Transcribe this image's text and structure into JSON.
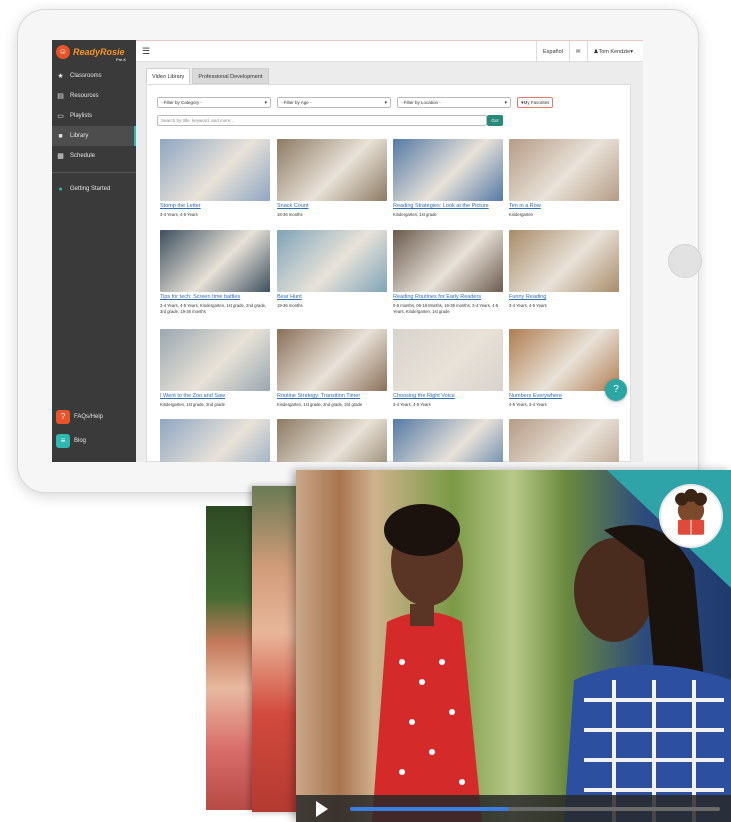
{
  "app": {
    "logo_text": "ReadyRosie",
    "logo_sub": "Pre-K"
  },
  "sidebar": {
    "items": [
      {
        "label": "Classrooms",
        "icon": "star-icon"
      },
      {
        "label": "Resources",
        "icon": "file-icon"
      },
      {
        "label": "Playlists",
        "icon": "monitor-icon"
      },
      {
        "label": "Library",
        "icon": "video-icon",
        "active": true
      },
      {
        "label": "Schedule",
        "icon": "calendar-icon"
      }
    ],
    "getting_started": "Getting Started",
    "faq": "FAQs/Help",
    "blog": "Blog"
  },
  "topbar": {
    "language": "Español",
    "user": "Tom Kendzie"
  },
  "tabs": [
    {
      "label": "Video Library",
      "active": true
    },
    {
      "label": "Professional Development",
      "active": false
    }
  ],
  "filters": {
    "category": "- Filter by Category -",
    "age": "- Filter by Age -",
    "location": "- Filter by Location -",
    "favorites": "My Favorites"
  },
  "search": {
    "placeholder": "Search by title, keyword, and more...",
    "button": "Go!"
  },
  "videos": [
    {
      "title": "Stomp the Letter",
      "meta": "3-4 Years, 4-5 Years"
    },
    {
      "title": "Snack Count",
      "meta": "18-36 months"
    },
    {
      "title": "Reading Strategies: Look at the Picture",
      "meta": "Kindergarten, 1st grade"
    },
    {
      "title": "Ten in a Row",
      "meta": "Kindergarten"
    },
    {
      "title": "Tips for tech: Screen time battles",
      "meta": "3-4 Years, 4-5 Years, Kindergarten, 1st grade, 2nd grade, 3rd grade, 19-36 months"
    },
    {
      "title": "Bear Hunt",
      "meta": "19-36 months"
    },
    {
      "title": "Reading Routines for Early Readers",
      "meta": "0-6 months, 06-18 Months, 19-36 months, 3-4 Years, 4-5 Years, Kindergarten, 1st grade"
    },
    {
      "title": "Funny Reading",
      "meta": "3-4 Years, 4-5 Years"
    },
    {
      "title": "I Went to the Zoo and Saw",
      "meta": "Kindergarten, 1st grade, 2nd grade"
    },
    {
      "title": "Routine Strategy: Transition Timer",
      "meta": "Kindergarten, 1st grade, 2nd grade, 3rd grade"
    },
    {
      "title": "Choosing the Right Voice",
      "meta": "3-4 Years, 4-5 Years"
    },
    {
      "title": "Numbers Everywhere",
      "meta": "4-5 Years, 3-4 Years"
    }
  ],
  "thumb_colors": [
    "#8fa6c2",
    "#8c7a63",
    "#5479a6",
    "#b59b86",
    "#3c4f5e",
    "#7fa4b8",
    "#6b5a4e",
    "#a88c6a",
    "#9aa7b0",
    "#8a6f59",
    "#d8d3cd",
    "#b07d52",
    "#8fa6c2",
    "#8c7a63",
    "#5479a6",
    "#b59b86"
  ],
  "video_player": {
    "progress": 0.43
  },
  "colors": {
    "accent": "#2fb7b0",
    "link": "#2f6db3",
    "sidebar": "#3a3a3a"
  }
}
